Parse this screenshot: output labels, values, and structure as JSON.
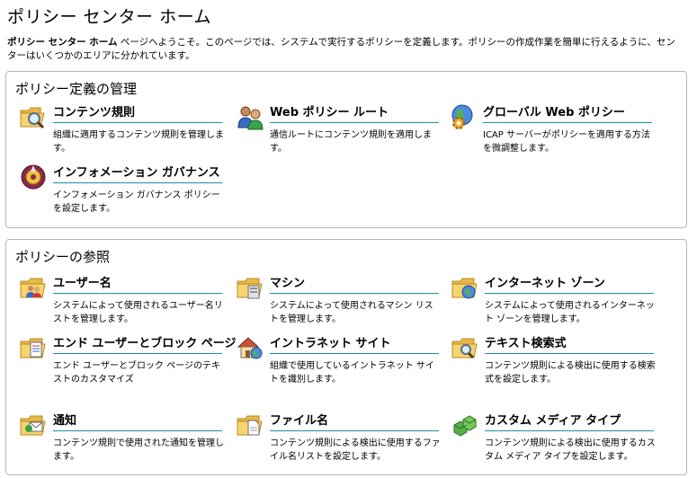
{
  "page": {
    "title": "ポリシー センター ホーム",
    "intro_bold": "ポリシー センター ホーム",
    "intro_text": " ページへようこそ。このページでは、システムで実行するポリシーを定義します。ポリシーの作成作業を簡単に行えるように、センターはいくつかのエリアに分かれています。"
  },
  "sections": [
    {
      "title": "ポリシー定義の管理",
      "items": [
        {
          "title": "コンテンツ規則",
          "desc": "組織に適用するコンテンツ規則を管理します。",
          "icon": "folder-magnifier-icon"
        },
        {
          "title": "Web ポリシー ルート",
          "desc": "通信ルートにコンテンツ規則を適用します。",
          "icon": "users-route-icon"
        },
        {
          "title": "グローバル Web ポリシー",
          "desc": "ICAP サーバーがポリシーを適用する方法を微調整します。",
          "icon": "globe-gear-icon"
        },
        {
          "title": "インフォメーション ガバナンス",
          "desc": "インフォメーション ガバナンス ポリシーを設定します。",
          "icon": "governance-icon"
        }
      ]
    },
    {
      "title": "ポリシーの参照",
      "items": [
        {
          "title": "ユーザー名",
          "desc": "システムによって使用されるユーザー名リストを管理します。",
          "icon": "folder-users-icon"
        },
        {
          "title": "マシン",
          "desc": "システムによって使用されるマシン リストを管理します。",
          "icon": "folder-machine-icon"
        },
        {
          "title": "インターネット ゾーン",
          "desc": "システムによって使用されるインターネット ゾーンを管理します。",
          "icon": "folder-globe-icon"
        },
        {
          "title": "エンド ユーザーとブロック ページ",
          "desc": "エンド ユーザーとブロック ページのテキストのカスタマイズ",
          "icon": "folder-document-icon"
        },
        {
          "title": "イントラネット サイト",
          "desc": "組織で使用しているイントラネット サイトを識別します。",
          "icon": "house-globe-icon"
        },
        {
          "title": "テキスト検索式",
          "desc": "コンテンツ規則による検出に使用する検索式を設定します。",
          "icon": "folder-search-icon"
        },
        {
          "title": "通知",
          "desc": "コンテンツ規則で使用された通知を管理します。",
          "icon": "folder-mail-icon"
        },
        {
          "title": "ファイル名",
          "desc": "コンテンツ規則による検出に使用するファイル名リストを設定します。",
          "icon": "folder-file-icon"
        },
        {
          "title": "カスタム メディア タイプ",
          "desc": "コンテンツ規則による検出に使用するカスタム メディア タイプを設定します。",
          "icon": "cubes-icon"
        }
      ]
    }
  ]
}
